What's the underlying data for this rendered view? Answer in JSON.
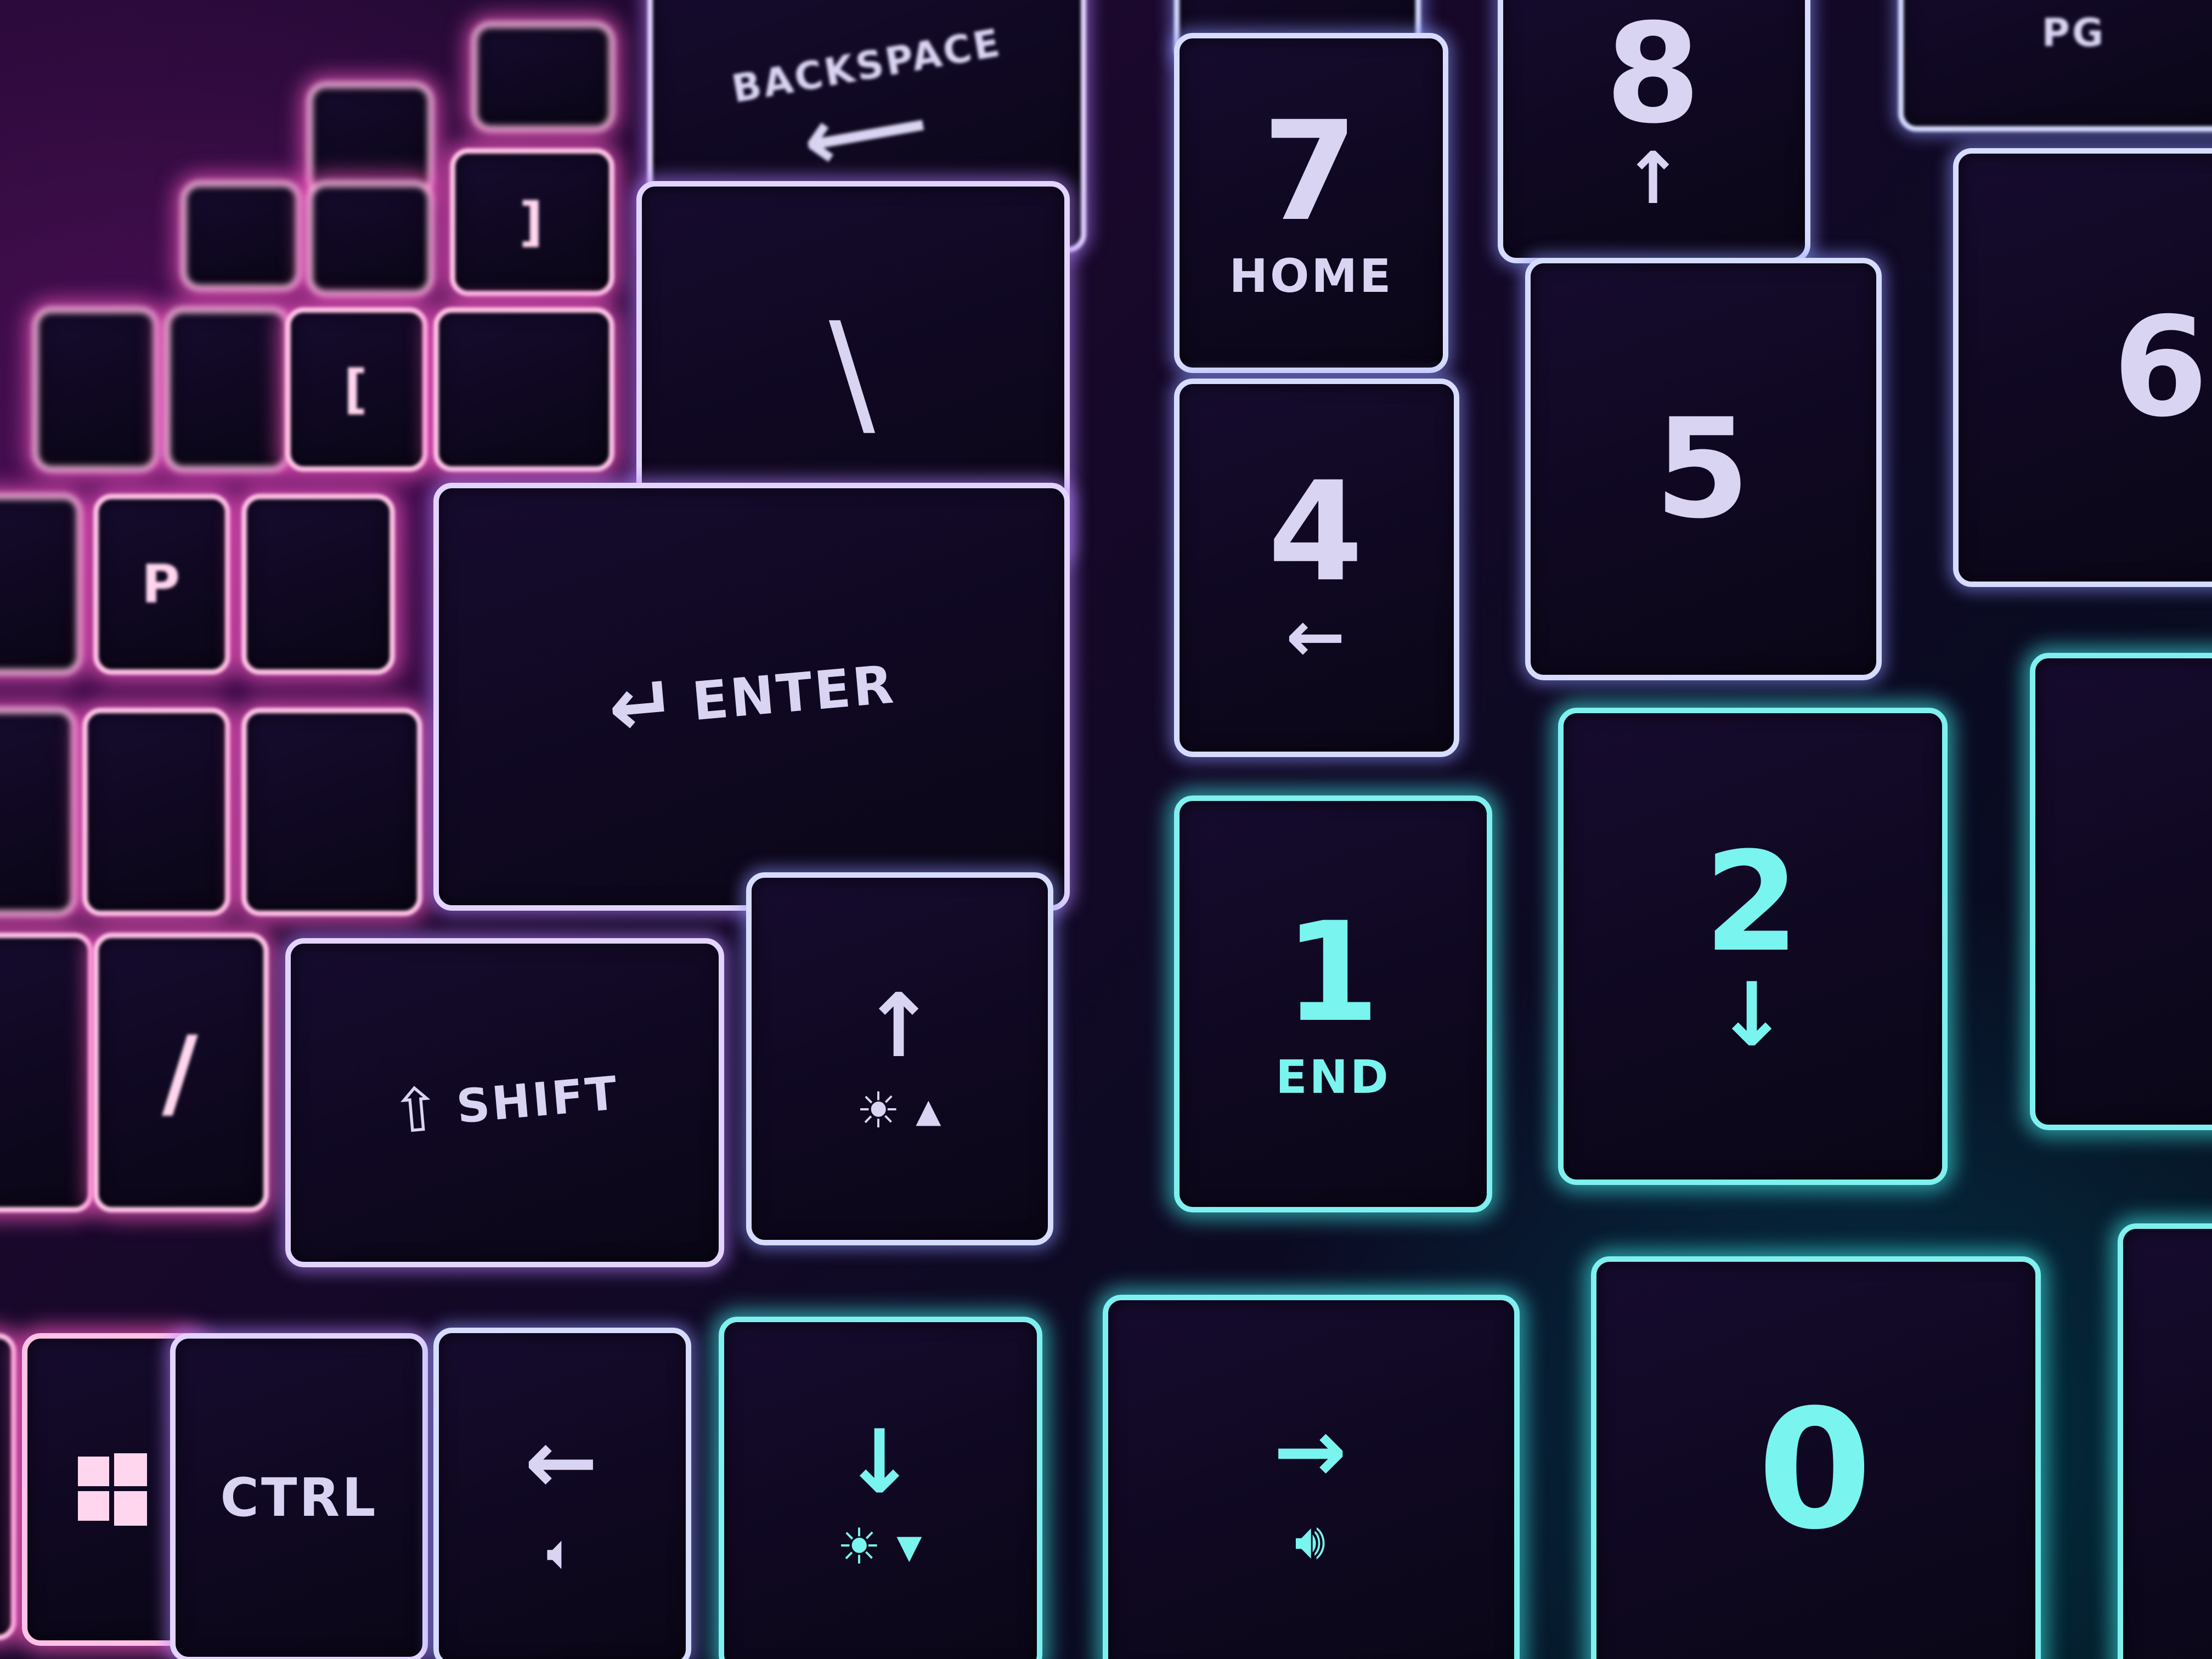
{
  "keys": {
    "backspace": "BACKSPACE",
    "enter": "ENTER",
    "shift": "SHIFT",
    "ctrl": "CTRL",
    "num7": "7",
    "num7_sub": "HOME",
    "num8": "8",
    "num4": "4",
    "num5": "5",
    "num1": "1",
    "num1_sub": "END",
    "num2": "2",
    "num0": "0",
    "slash": "/",
    "backslash": "\\",
    "bracket_close": "]",
    "bracket_open": "[",
    "p": "P",
    "pgup": "PG"
  },
  "icons": {
    "enter_arrow": "return-arrow-icon",
    "up_arrow": "arrow-up-icon",
    "down_arrow": "arrow-down-icon",
    "left_arrow": "arrow-left-icon",
    "right_arrow": "arrow-right-icon",
    "brightness": "brightness-icon",
    "volume": "volume-icon",
    "windows": "windows-logo-icon"
  },
  "colors": {
    "pink_glow": "#ff5ac8",
    "violet_glow": "#b482ff",
    "cyan_glow": "#3cdcdc",
    "keycap": "#0e0820"
  }
}
